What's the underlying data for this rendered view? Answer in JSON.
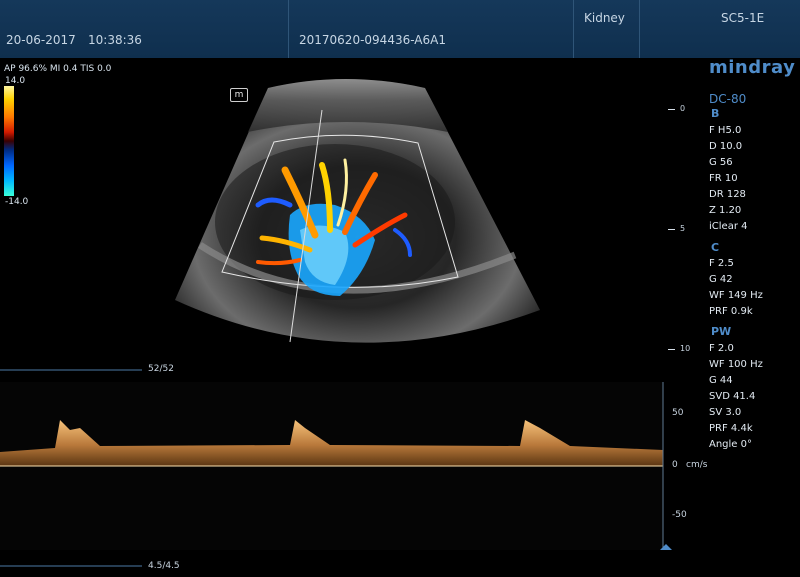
{
  "header": {
    "date": "20-06-2017",
    "time": "10:38:36",
    "exam_id": "20170620-094436-A6A1",
    "preset": "Kidney",
    "probe": "SC5-1E"
  },
  "overlay": {
    "acoustic_power": "AP 96.6%  MI 0.4  TIS 0.0",
    "color_scale_max": "14.0",
    "color_scale_min": "-14.0",
    "logo_letter": "m"
  },
  "device": {
    "brand": "mindray",
    "model": "DC-80"
  },
  "b_mode": {
    "heading": "B",
    "params": [
      "F H5.0",
      "D 10.0",
      "G 56",
      "FR 10",
      "DR 128",
      "Z 1.20",
      "iClear 4"
    ]
  },
  "color_mode": {
    "heading": "C",
    "params": [
      "F 2.5",
      "G 42",
      "WF 149 Hz",
      "PRF 0.9k"
    ]
  },
  "pw_mode": {
    "heading": "PW",
    "params": [
      "F 2.0",
      "WF 100 Hz",
      "G 44",
      "SVD 41.4",
      "SV 3.0",
      "PRF 4.4k",
      "Angle   0°"
    ]
  },
  "depth_scale": {
    "labels": [
      "0",
      "5",
      "10"
    ]
  },
  "spectral": {
    "top_marker": "52/52",
    "bottom_marker": "4.5/4.5",
    "velocity_labels": [
      "50",
      "0",
      "-50"
    ],
    "velocity_unit": "cm/s"
  },
  "colors": {
    "header_bg": "#15385a",
    "accent_blue": "#4f8cc9",
    "doppler_gold": "#e8b060"
  }
}
